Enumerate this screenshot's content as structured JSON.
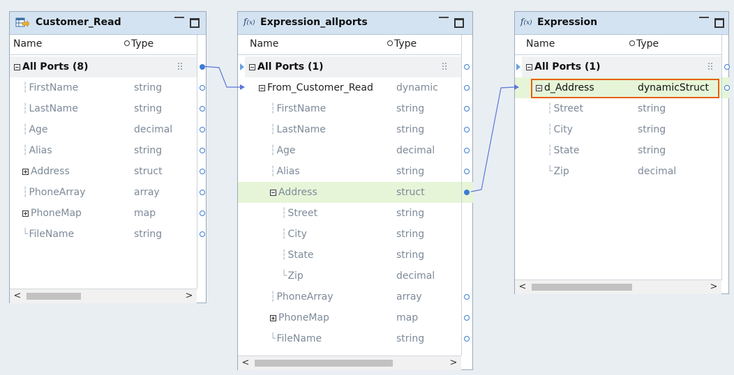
{
  "colors": {
    "link": "#5b77d6",
    "selection": "#e85f10",
    "highlight_row": "#e6f5d8"
  },
  "panels": {
    "customer_read": {
      "title": "Customer_Read",
      "icon": "read-table-icon",
      "col_name": "Name",
      "col_type": "Type",
      "all_ports": "All Ports (8)",
      "rows": [
        {
          "name": "FirstName",
          "type": "string"
        },
        {
          "name": "LastName",
          "type": "string"
        },
        {
          "name": "Age",
          "type": "decimal"
        },
        {
          "name": "Alias",
          "type": "string"
        },
        {
          "name": "Address",
          "type": "struct"
        },
        {
          "name": "PhoneArray",
          "type": "array"
        },
        {
          "name": "PhoneMap",
          "type": "map"
        },
        {
          "name": "FileName",
          "type": "string"
        }
      ]
    },
    "expression_allports": {
      "title": "Expression_allports",
      "icon": "fx",
      "col_name": "Name",
      "col_type": "Type",
      "all_ports": "All Ports (1)",
      "rows": [
        {
          "name": "From_Customer_Read",
          "type": "dynamic"
        },
        {
          "name": "FirstName",
          "type": "string"
        },
        {
          "name": "LastName",
          "type": "string"
        },
        {
          "name": "Age",
          "type": "decimal"
        },
        {
          "name": "Alias",
          "type": "string"
        },
        {
          "name": "Address",
          "type": "struct"
        },
        {
          "name": "Street",
          "type": "string"
        },
        {
          "name": "City",
          "type": "string"
        },
        {
          "name": "State",
          "type": "string"
        },
        {
          "name": "Zip",
          "type": "decimal"
        },
        {
          "name": "PhoneArray",
          "type": "array"
        },
        {
          "name": "PhoneMap",
          "type": "map"
        },
        {
          "name": "FileName",
          "type": "string"
        }
      ]
    },
    "expression": {
      "title": "Expression",
      "icon": "fx",
      "col_name": "Name",
      "col_type": "Type",
      "all_ports": "All Ports (1)",
      "rows": [
        {
          "name": "d_Address",
          "type": "dynamicStruct"
        },
        {
          "name": "Street",
          "type": "string"
        },
        {
          "name": "City",
          "type": "string"
        },
        {
          "name": "State",
          "type": "string"
        },
        {
          "name": "Zip",
          "type": "decimal"
        }
      ]
    }
  }
}
